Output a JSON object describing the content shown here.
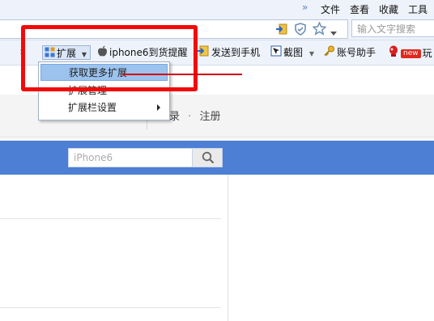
{
  "menubar": {
    "items": [
      "文件",
      "查看",
      "收藏",
      "工具"
    ],
    "chevron": "»"
  },
  "addressbar": {
    "search_placeholder": "输入文字搜索"
  },
  "extbar": {
    "nav_arrow": "›",
    "extensions_label": "扩展",
    "buttons": [
      {
        "label": "iphone6到货提醒",
        "icon": "apple-icon"
      },
      {
        "label": "发送到手机",
        "icon": "send-to-phone-icon"
      },
      {
        "label": "截图",
        "icon": "screenshot-icon"
      },
      {
        "label": "账号助手",
        "icon": "key-icon"
      },
      {
        "label": "玩",
        "icon": "game-icon",
        "badge": "new"
      }
    ]
  },
  "dropdown": {
    "items": [
      "获取更多扩展",
      "扩展管理",
      "扩展栏设置"
    ],
    "highlighted_index": 0
  },
  "page": {
    "login": "登录",
    "separator": "·",
    "register": "注册",
    "search_placeholder": "iPhone6"
  },
  "colors": {
    "annotation": "#f20a0a",
    "nav_bar": "#4d7fd4",
    "highlight": "#9cc3ee"
  }
}
